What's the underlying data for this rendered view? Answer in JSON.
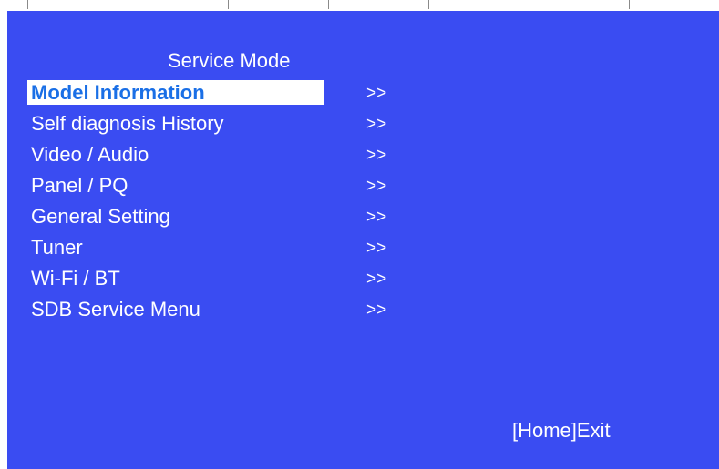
{
  "title": "Service Mode",
  "menu": {
    "items": [
      {
        "label": "Model Information",
        "arrow": ">>",
        "selected": true
      },
      {
        "label": "Self diagnosis History",
        "arrow": ">>",
        "selected": false
      },
      {
        "label": "Video / Audio",
        "arrow": ">>",
        "selected": false
      },
      {
        "label": "Panel / PQ",
        "arrow": ">>",
        "selected": false
      },
      {
        "label": "General Setting",
        "arrow": ">>",
        "selected": false
      },
      {
        "label": "Tuner",
        "arrow": ">>",
        "selected": false
      },
      {
        "label": "Wi-Fi / BT",
        "arrow": ">>",
        "selected": false
      },
      {
        "label": "SDB Service Menu",
        "arrow": ">>",
        "selected": false
      }
    ]
  },
  "footer": {
    "exit_hint": "[Home]Exit"
  },
  "colors": {
    "background": "#3a4cf2",
    "text": "#ffffff",
    "selected_background": "#ffffff",
    "selected_text": "#1a6fe6"
  }
}
